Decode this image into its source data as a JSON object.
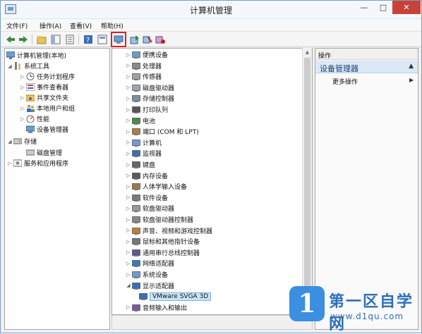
{
  "window": {
    "title": "计算机管理",
    "minimize": "—",
    "maximize": "□",
    "close": "✕"
  },
  "menu": [
    "文件(F)",
    "操作(A)",
    "查看(V)",
    "帮助(H)"
  ],
  "toolbar": {
    "icons": [
      "back-arrow-icon",
      "forward-arrow-icon",
      "up-folder-icon",
      "show-hide-tree-icon",
      "properties-icon",
      "help-icon",
      "export-list-icon",
      "device-manager-icon",
      "update-driver-icon",
      "disable-device-icon",
      "uninstall-device-icon"
    ],
    "highlight_color": "#e02020"
  },
  "left_tree": [
    {
      "label": "计算机管理(本地)",
      "indent": 0,
      "arrow": "",
      "icon": "computer-mgmt-icon"
    },
    {
      "label": "系统工具",
      "indent": 1,
      "arrow": "◢",
      "icon": "tools-icon"
    },
    {
      "label": "任务计划程序",
      "indent": 2,
      "arrow": "▷",
      "icon": "clock-icon"
    },
    {
      "label": "事件查看器",
      "indent": 2,
      "arrow": "▷",
      "icon": "event-viewer-icon"
    },
    {
      "label": "共享文件夹",
      "indent": 2,
      "arrow": "▷",
      "icon": "shared-folder-icon"
    },
    {
      "label": "本地用户和组",
      "indent": 2,
      "arrow": "▷",
      "icon": "users-icon"
    },
    {
      "label": "性能",
      "indent": 2,
      "arrow": "▷",
      "icon": "performance-icon"
    },
    {
      "label": "设备管理器",
      "indent": 2,
      "arrow": "",
      "icon": "device-manager-icon"
    },
    {
      "label": "存储",
      "indent": 0,
      "arrow": "◢",
      "icon": "storage-icon"
    },
    {
      "label": "磁盘管理",
      "indent": 1,
      "arrow": "",
      "icon": "disk-icon"
    },
    {
      "label": "服务和应用程序",
      "indent": 0,
      "arrow": "▷",
      "icon": "services-icon"
    }
  ],
  "device_tree": [
    {
      "label": "便携设备",
      "arrow": "▷",
      "icon": "portable-device-icon"
    },
    {
      "label": "处理器",
      "arrow": "▷",
      "icon": "processor-icon"
    },
    {
      "label": "传感器",
      "arrow": "▷",
      "icon": "sensor-icon"
    },
    {
      "label": "磁盘驱动器",
      "arrow": "▷",
      "icon": "disk-drive-icon"
    },
    {
      "label": "存储控制器",
      "arrow": "▷",
      "icon": "storage-controller-icon"
    },
    {
      "label": "打印队列",
      "arrow": "▷",
      "icon": "printer-icon"
    },
    {
      "label": "电池",
      "arrow": "▷",
      "icon": "battery-icon"
    },
    {
      "label": "端口 (COM 和 LPT)",
      "arrow": "▷",
      "icon": "port-icon"
    },
    {
      "label": "计算机",
      "arrow": "▷",
      "icon": "computer-icon"
    },
    {
      "label": "监视器",
      "arrow": "▷",
      "icon": "monitor-icon"
    },
    {
      "label": "键盘",
      "arrow": "▷",
      "icon": "keyboard-icon"
    },
    {
      "label": "内存设备",
      "arrow": "▷",
      "icon": "memory-icon"
    },
    {
      "label": "人体学输入设备",
      "arrow": "▷",
      "icon": "hid-icon"
    },
    {
      "label": "软件设备",
      "arrow": "▷",
      "icon": "software-device-icon"
    },
    {
      "label": "软盘驱动器",
      "arrow": "▷",
      "icon": "floppy-drive-icon"
    },
    {
      "label": "软盘驱动器控制器",
      "arrow": "▷",
      "icon": "floppy-controller-icon"
    },
    {
      "label": "声音、视频和游戏控制器",
      "arrow": "▷",
      "icon": "sound-icon"
    },
    {
      "label": "鼠标和其他指针设备",
      "arrow": "▷",
      "icon": "mouse-icon"
    },
    {
      "label": "通用串行总线控制器",
      "arrow": "▷",
      "icon": "usb-icon"
    },
    {
      "label": "网络适配器",
      "arrow": "▷",
      "icon": "network-adapter-icon"
    },
    {
      "label": "系统设备",
      "arrow": "▷",
      "icon": "system-device-icon"
    },
    {
      "label": "显示适配器",
      "arrow": "◢",
      "icon": "display-adapter-icon"
    },
    {
      "label": "VMware SVGA 3D",
      "arrow": "",
      "icon": "display-adapter-icon",
      "child": true,
      "selected": true
    },
    {
      "label": "音频输入和输出",
      "arrow": "▷",
      "icon": "audio-io-icon"
    }
  ],
  "actions": {
    "header": "操作",
    "section": "设备管理器",
    "more": "更多操作"
  },
  "watermark": {
    "logo": "1",
    "name": "第一区自学网",
    "url": "www.d1qu.com"
  }
}
